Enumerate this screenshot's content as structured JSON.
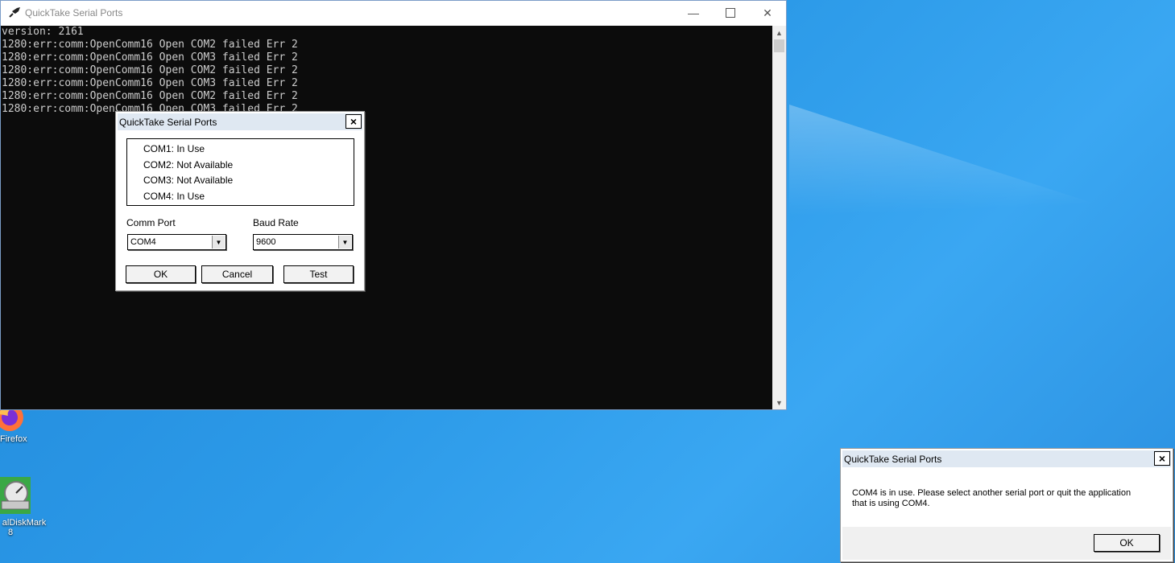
{
  "console": {
    "title": "QuickTake Serial Ports",
    "lines": [
      "version: 2161",
      "1280:err:comm:OpenComm16 Open COM2 failed Err 2",
      "1280:err:comm:OpenComm16 Open COM3 failed Err 2",
      "1280:err:comm:OpenComm16 Open COM2 failed Err 2",
      "1280:err:comm:OpenComm16 Open COM3 failed Err 2",
      "1280:err:comm:OpenComm16 Open COM2 failed Err 2",
      "1280:err:comm:OpenComm16 Open COM3 failed Err 2"
    ]
  },
  "port_dialog": {
    "title": "QuickTake Serial Ports",
    "ports": [
      "COM1:  In Use",
      "COM2:  Not Available",
      "COM3:  Not Available",
      "COM4:  In Use"
    ],
    "comm_port_label": "Comm Port",
    "comm_port_value": "COM4",
    "baud_rate_label": "Baud Rate",
    "baud_rate_value": "9600",
    "ok_label": "OK",
    "cancel_label": "Cancel",
    "test_label": "Test"
  },
  "message_dialog": {
    "title": "QuickTake Serial Ports",
    "message_line1": "COM4 is in use.  Please select another serial port or quit the application",
    "message_line2": "that is using COM4.",
    "ok_label": "OK"
  },
  "desktop": {
    "icons": [
      {
        "label": "Firefox",
        "icon": "firefox-icon"
      },
      {
        "label": "alDiskMark",
        "label2": "8",
        "icon": "crystaldiskmark-icon"
      }
    ]
  }
}
